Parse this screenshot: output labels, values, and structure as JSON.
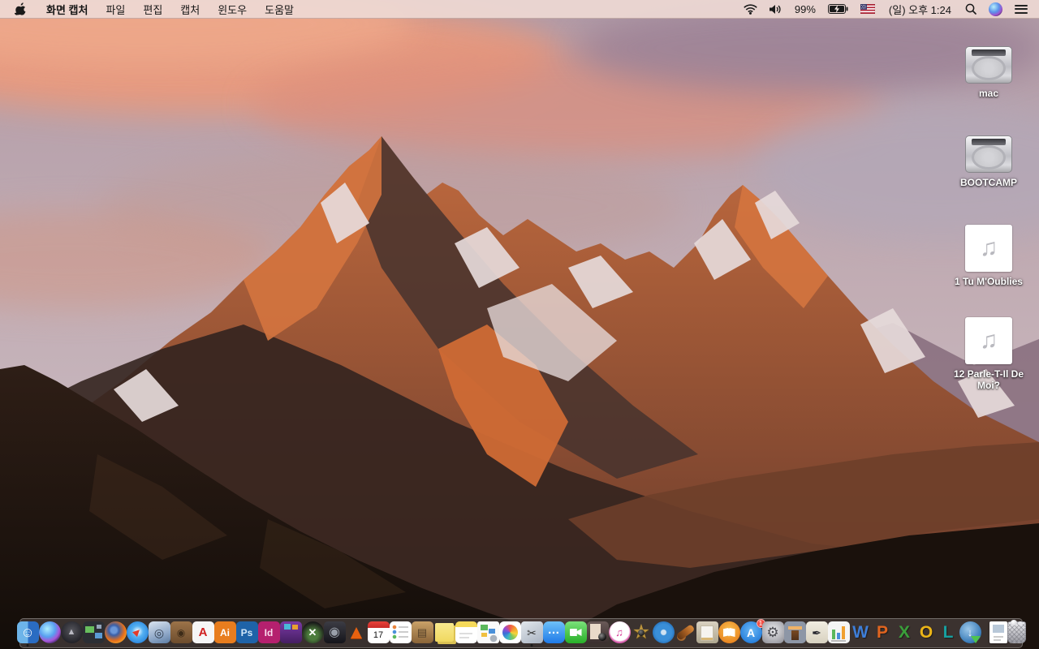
{
  "menubar": {
    "app_name": "화면 캡처",
    "menus": [
      "파일",
      "편집",
      "캡처",
      "윈도우",
      "도움말"
    ],
    "status": {
      "battery_percent": "99%",
      "clock": "(일) 오후 1:24"
    }
  },
  "desktop": {
    "icons": [
      {
        "label": "mac",
        "type": "hard-drive",
        "glyph": ""
      },
      {
        "label": "BOOTCAMP",
        "type": "hard-drive",
        "glyph": ""
      },
      {
        "label": "1 Tu M'Oublies",
        "type": "audio-file",
        "glyph": "♫"
      },
      {
        "label": "12 Parle-T-Il De Moi?",
        "type": "audio-file",
        "glyph": "♫"
      }
    ],
    "tops": [
      34,
      144,
      254,
      368
    ]
  },
  "dock": {
    "items": [
      {
        "name": "finder",
        "cls": "ic-finder",
        "glyph": "☺",
        "running": true
      },
      {
        "name": "siri",
        "cls": "ic-siri",
        "glyph": ""
      },
      {
        "name": "launchpad",
        "cls": "ic-launchpad",
        "glyph": "▲"
      },
      {
        "name": "mission-control",
        "cls": "ic-mission",
        "glyph": ""
      },
      {
        "name": "firefox",
        "cls": "ic-firefox",
        "glyph": ""
      },
      {
        "name": "safari",
        "cls": "ic-safari",
        "glyph": "▶",
        "glyphCls": "needle"
      },
      {
        "name": "preview",
        "cls": "ic-preview",
        "glyph": "◎"
      },
      {
        "name": "brown-book-app",
        "cls": "ic-brownbook",
        "glyph": "◉"
      },
      {
        "name": "acrobat-reader",
        "cls": "ic-acrobat",
        "glyph": "A"
      },
      {
        "name": "illustrator",
        "cls": "ic-ai",
        "glyph": "Ai"
      },
      {
        "name": "photoshop",
        "cls": "ic-ps",
        "glyph": "Ps"
      },
      {
        "name": "indesign",
        "cls": "ic-id",
        "glyph": "Id"
      },
      {
        "name": "toast-titanium",
        "cls": "ic-toast",
        "glyph": ""
      },
      {
        "name": "xee-image-viewer",
        "cls": "ic-xee",
        "glyph": "✕"
      },
      {
        "name": "disk-tool",
        "cls": "ic-disktool",
        "glyph": "◉"
      },
      {
        "name": "vlc",
        "cls": "ic-vlc",
        "glyph": "▲",
        "glyphCls": "cone"
      },
      {
        "name": "calendar",
        "cls": "ic-calendar",
        "glyph": "17"
      },
      {
        "name": "reminders",
        "cls": "ic-reminders",
        "glyph": ""
      },
      {
        "name": "stuffit-expander",
        "cls": "ic-stuffit",
        "glyph": "▤"
      },
      {
        "name": "stickies",
        "cls": "ic-stickies",
        "glyph": ""
      },
      {
        "name": "notes",
        "cls": "ic-notes",
        "glyph": ""
      },
      {
        "name": "stationery-app",
        "cls": "ic-templates",
        "glyph": ""
      },
      {
        "name": "photos",
        "cls": "ic-photos",
        "glyph": ""
      },
      {
        "name": "grab-screen-capture",
        "cls": "ic-grab",
        "glyph": "✂",
        "running": true
      },
      {
        "name": "messages",
        "cls": "ic-messages",
        "glyph": "…"
      },
      {
        "name": "facetime",
        "cls": "ic-facetime",
        "glyph": ""
      },
      {
        "name": "photo-booth",
        "cls": "ic-photobooth",
        "glyph": ""
      },
      {
        "name": "itunes",
        "cls": "ic-itunes",
        "glyph": "♫"
      },
      {
        "name": "imovie",
        "cls": "ic-imovie",
        "glyph": "★",
        "glyphCls": "star"
      },
      {
        "name": "idvd",
        "cls": "ic-idvd",
        "glyph": ""
      },
      {
        "name": "garageband",
        "cls": "ic-garageband",
        "glyph": ""
      },
      {
        "name": "clipboard-docs-app",
        "cls": "ic-clipboard",
        "glyph": ""
      },
      {
        "name": "ibooks",
        "cls": "ic-ibooks",
        "glyph": ""
      },
      {
        "name": "app-store",
        "cls": "ic-appstore",
        "glyph": "A",
        "badge": "1"
      },
      {
        "name": "system-preferences",
        "cls": "ic-sysprefs",
        "glyph": "⚙"
      },
      {
        "name": "keynote-classic",
        "cls": "ic-keynote",
        "glyph": ""
      },
      {
        "name": "pages-classic",
        "cls": "ic-pagesold",
        "glyph": "✒"
      },
      {
        "name": "numbers-classic",
        "cls": "ic-numbersold",
        "glyph": ""
      },
      {
        "name": "word",
        "cls": "ic-word",
        "glyph": "W",
        "glyphCls": "letter c-word"
      },
      {
        "name": "powerpoint",
        "cls": "ic-ppt",
        "glyph": "P",
        "glyphCls": "letter c-ppt"
      },
      {
        "name": "excel",
        "cls": "ic-excel",
        "glyph": "X",
        "glyphCls": "letter c-excel"
      },
      {
        "name": "outlook",
        "cls": "ic-outlook",
        "glyph": "O",
        "glyphCls": "letter c-outlook"
      },
      {
        "name": "lync",
        "cls": "ic-lync",
        "glyph": "L",
        "glyphCls": "letter c-lync"
      },
      {
        "name": "web-downloader",
        "cls": "ic-globe",
        "glyph": "↓"
      },
      {
        "type": "separator"
      },
      {
        "name": "document-file",
        "cls": "ic-filedoc",
        "glyph": ""
      },
      {
        "name": "trash",
        "cls": "ic-trash",
        "glyph": ""
      }
    ]
  },
  "colors": {
    "menubar_bg": "#eed9d4",
    "dock_bg": "rgba(88,78,76,0.55)",
    "badge_red": "#d81f1f",
    "label_text": "#ffffff"
  }
}
